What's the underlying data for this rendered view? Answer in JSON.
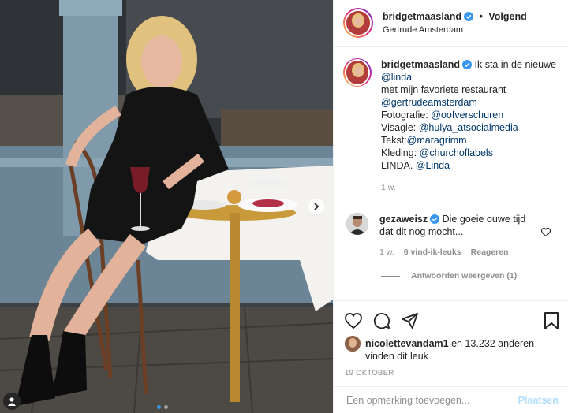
{
  "header": {
    "username": "bridgetmaasland",
    "separator": "•",
    "follow_label": "Volgend",
    "location": "Gertrude Amsterdam"
  },
  "caption": {
    "username": "bridgetmaasland",
    "text_1": "Ik sta in de nieuwe",
    "mention_linda": "@linda",
    "text_2": "met mijn favoriete restaurant",
    "mention_restaurant": "@gertrudeamsterdam",
    "photo_label": "Fotografie:",
    "mention_photo": "@oofverschuren",
    "visagie_label": "Visagie:",
    "mention_visagie": "@hulya_atsocialmedia",
    "tekst_label": "Tekst:",
    "mention_tekst": "@maragrimm",
    "kleding_label": "Kleding:",
    "mention_kleding": "@churchoflabels",
    "linda_text": "LINDA.",
    "mention_linda2": "@Linda",
    "time": "1 w."
  },
  "comment": {
    "username": "gezaweisz",
    "text": "Die goeie ouwe tijd dat dit nog mocht...",
    "time": "1 w.",
    "likes": "6 vind-ik-leuks",
    "reply_label": "Reageren",
    "view_replies": "Antwoorden weergeven (1)"
  },
  "likes": {
    "username": "nicolettevandam1",
    "text_mid": "en 13.232 anderen",
    "text_end": "vinden dit leuk"
  },
  "date": "19 OKTOBER",
  "add_comment": {
    "placeholder": "Een opmerking toevoegen...",
    "post_label": "Plaatsen"
  },
  "carousel": {
    "slides": 2,
    "active_slide": 1
  },
  "colors": {
    "text": "#262626",
    "secondary": "#8e8e8e",
    "mention": "#00376b",
    "verified": "#3897f0",
    "post_disabled": "#b2dffc",
    "border": "#efefef"
  },
  "icons": [
    "verified-badge-icon",
    "heart-icon",
    "comment-icon",
    "share-icon",
    "bookmark-icon",
    "chevron-right-icon",
    "user-tag-icon"
  ]
}
